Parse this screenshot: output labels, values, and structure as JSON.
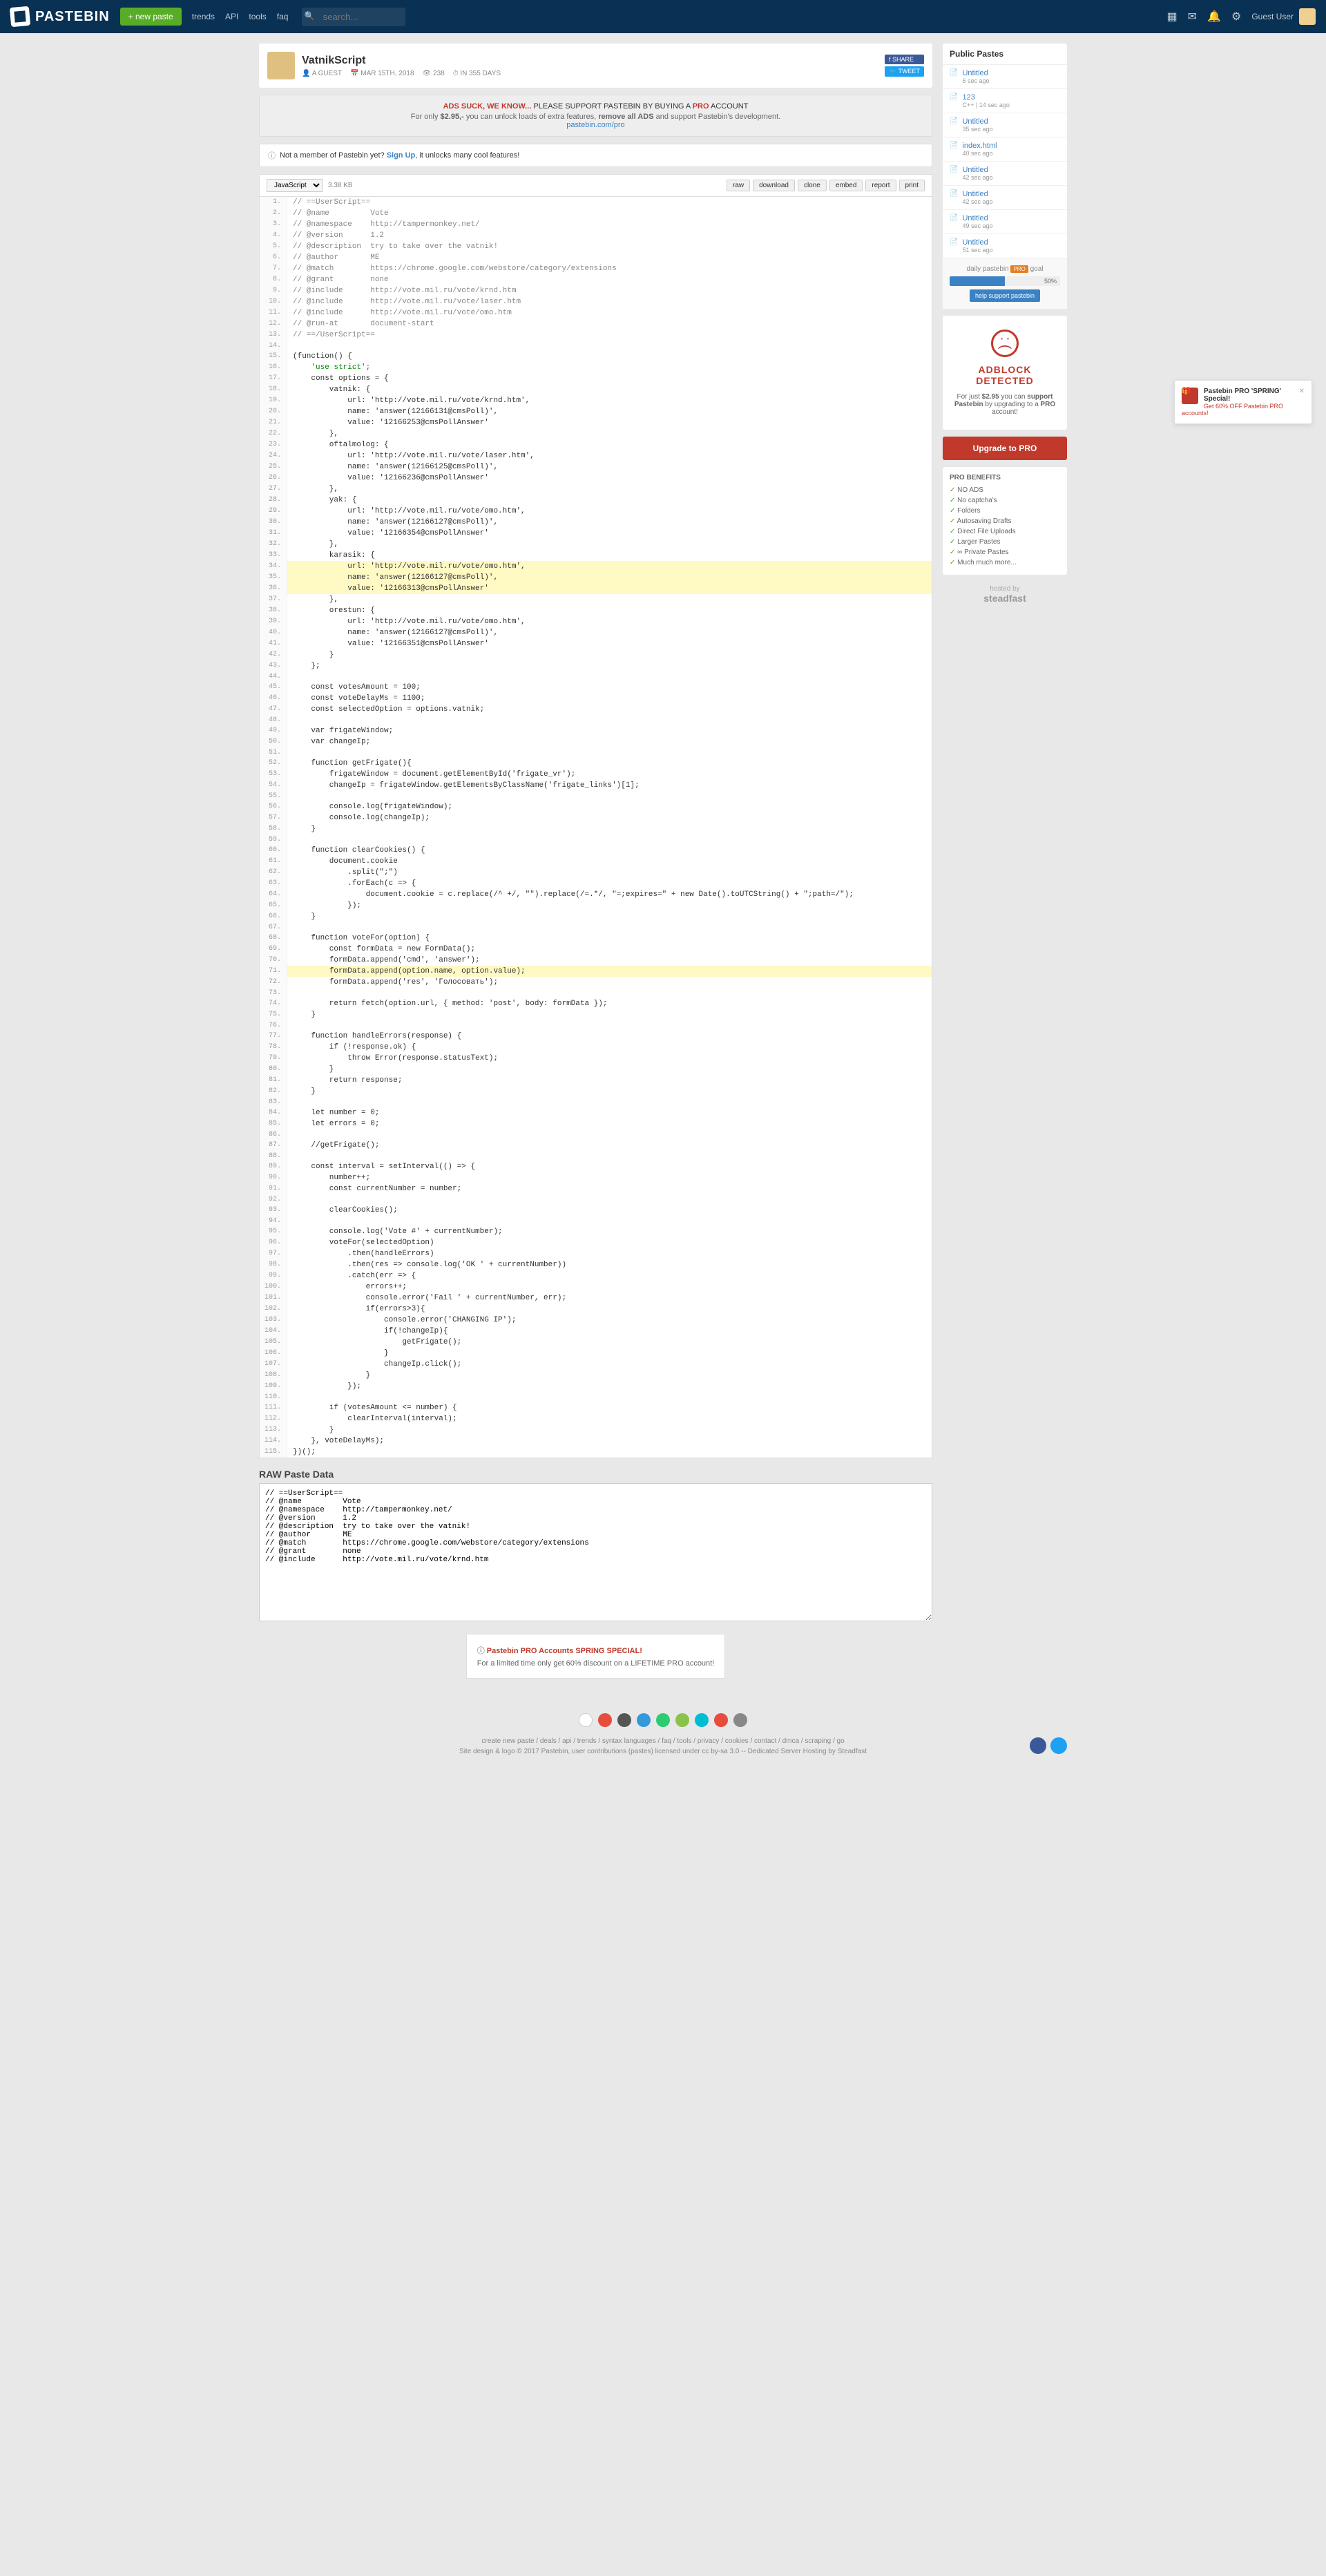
{
  "header": {
    "logo": "PASTEBIN",
    "new_paste": "+ new paste",
    "nav": [
      "trends",
      "API",
      "tools",
      "faq"
    ],
    "search_placeholder": "search...",
    "guest": "Guest User"
  },
  "paste": {
    "title": "VatnikScript",
    "author": "A GUEST",
    "date": "MAR 15TH, 2018",
    "views": "238",
    "expires": "IN 355 DAYS",
    "share": "SHARE",
    "tweet": "TWEET",
    "lang": "JavaScript",
    "size": "3.38 KB"
  },
  "ads": {
    "title": "ADS SUCK, WE KNOW...",
    "suffix": " PLEASE SUPPORT PASTEBIN BY BUYING A ",
    "pro": "PRO",
    "account": " ACCOUNT",
    "text1": "For only ",
    "price": "$2.95,-",
    "text2": " you can unlock loads of extra features, ",
    "bold": "remove all ADS",
    "text3": " and support Pastebin's development.",
    "link": "pastebin.com/pro"
  },
  "member": {
    "text1": "Not a member of Pastebin yet? ",
    "signup": "Sign Up",
    "text2": ", it unlocks many cool features!"
  },
  "toolbar": [
    "raw",
    "download",
    "clone",
    "embed",
    "report",
    "print"
  ],
  "code": [
    {
      "n": 1,
      "t": "// ==UserScript==",
      "c": "com"
    },
    {
      "n": 2,
      "t": "// @name         Vote",
      "c": "com"
    },
    {
      "n": 3,
      "t": "// @namespace    http://tampermonkey.net/",
      "c": "com"
    },
    {
      "n": 4,
      "t": "// @version      1.2",
      "c": "com"
    },
    {
      "n": 5,
      "t": "// @description  try to take over the vatnik!",
      "c": "com"
    },
    {
      "n": 6,
      "t": "// @author       ME",
      "c": "com"
    },
    {
      "n": 7,
      "t": "// @match        https://chrome.google.com/webstore/category/extensions",
      "c": "com"
    },
    {
      "n": 8,
      "t": "// @grant        none",
      "c": "com"
    },
    {
      "n": 9,
      "t": "// @include      http://vote.mil.ru/vote/krnd.htm",
      "c": "com"
    },
    {
      "n": 10,
      "t": "// @include      http://vote.mil.ru/vote/laser.htm",
      "c": "com"
    },
    {
      "n": 11,
      "t": "// @include      http://vote.mil.ru/vote/omo.htm",
      "c": "com"
    },
    {
      "n": 12,
      "t": "// @run-at       document-start",
      "c": "com"
    },
    {
      "n": 13,
      "t": "// ==/UserScript==",
      "c": "com"
    },
    {
      "n": 14,
      "t": ""
    },
    {
      "n": 15,
      "t": "(function() {"
    },
    {
      "n": 16,
      "t": "    'use strict';",
      "c": "str"
    },
    {
      "n": 17,
      "t": "    const options = {"
    },
    {
      "n": 18,
      "t": "        vatnik: {"
    },
    {
      "n": 19,
      "t": "            url: 'http://vote.mil.ru/vote/krnd.htm',"
    },
    {
      "n": 20,
      "t": "            name: 'answer(12166131@cmsPoll)',"
    },
    {
      "n": 21,
      "t": "            value: '12166253@cmsPollAnswer'"
    },
    {
      "n": 22,
      "t": "        },"
    },
    {
      "n": 23,
      "t": "        oftalmolog: {"
    },
    {
      "n": 24,
      "t": "            url: 'http://vote.mil.ru/vote/laser.htm',"
    },
    {
      "n": 25,
      "t": "            name: 'answer(12166125@cmsPoll)',"
    },
    {
      "n": 26,
      "t": "            value: '12166236@cmsPollAnswer'"
    },
    {
      "n": 27,
      "t": "        },"
    },
    {
      "n": 28,
      "t": "        yak: {"
    },
    {
      "n": 29,
      "t": "            url: 'http://vote.mil.ru/vote/omo.htm',"
    },
    {
      "n": 30,
      "t": "            name: 'answer(12166127@cmsPoll)',"
    },
    {
      "n": 31,
      "t": "            value: '12166354@cmsPollAnswer'"
    },
    {
      "n": 32,
      "t": "        },"
    },
    {
      "n": 33,
      "t": "        karasik: {"
    },
    {
      "n": 34,
      "t": "            url: 'http://vote.mil.ru/vote/omo.htm',",
      "hl": true
    },
    {
      "n": 35,
      "t": "            name: 'answer(12166127@cmsPoll)',",
      "hl": true
    },
    {
      "n": 36,
      "t": "            value: '12166313@cmsPollAnswer'",
      "hl": true
    },
    {
      "n": 37,
      "t": "        },"
    },
    {
      "n": 38,
      "t": "        orestun: {"
    },
    {
      "n": 39,
      "t": "            url: 'http://vote.mil.ru/vote/omo.htm',"
    },
    {
      "n": 40,
      "t": "            name: 'answer(12166127@cmsPoll)',"
    },
    {
      "n": 41,
      "t": "            value: '12166351@cmsPollAnswer'"
    },
    {
      "n": 42,
      "t": "        }"
    },
    {
      "n": 43,
      "t": "    };"
    },
    {
      "n": 44,
      "t": ""
    },
    {
      "n": 45,
      "t": "    const votesAmount = 100;"
    },
    {
      "n": 46,
      "t": "    const voteDelayMs = 1100;"
    },
    {
      "n": 47,
      "t": "    const selectedOption = options.vatnik;"
    },
    {
      "n": 48,
      "t": ""
    },
    {
      "n": 49,
      "t": "    var frigateWindow;"
    },
    {
      "n": 50,
      "t": "    var changeIp;"
    },
    {
      "n": 51,
      "t": ""
    },
    {
      "n": 52,
      "t": "    function getFrigate(){"
    },
    {
      "n": 53,
      "t": "        frigateWindow = document.getElementById('frigate_vr');"
    },
    {
      "n": 54,
      "t": "        changeIp = frigateWindow.getElementsByClassName('frigate_links')[1];"
    },
    {
      "n": 55,
      "t": ""
    },
    {
      "n": 56,
      "t": "        console.log(frigateWindow);"
    },
    {
      "n": 57,
      "t": "        console.log(changeIp);"
    },
    {
      "n": 58,
      "t": "    }"
    },
    {
      "n": 59,
      "t": ""
    },
    {
      "n": 60,
      "t": "    function clearCookies() {"
    },
    {
      "n": 61,
      "t": "        document.cookie"
    },
    {
      "n": 62,
      "t": "            .split(\";\")"
    },
    {
      "n": 63,
      "t": "            .forEach(c => {"
    },
    {
      "n": 64,
      "t": "                document.cookie = c.replace(/^ +/, \"\").replace(/=.*/, \"=;expires=\" + new Date().toUTCString() + \";path=/\");"
    },
    {
      "n": 65,
      "t": "            });"
    },
    {
      "n": 66,
      "t": "    }"
    },
    {
      "n": 67,
      "t": ""
    },
    {
      "n": 68,
      "t": "    function voteFor(option) {"
    },
    {
      "n": 69,
      "t": "        const formData = new FormData();"
    },
    {
      "n": 70,
      "t": "        formData.append('cmd', 'answer');"
    },
    {
      "n": 71,
      "t": "        formData.append(option.name, option.value);",
      "hl": true
    },
    {
      "n": 72,
      "t": "        formData.append('res', 'Голосовать');"
    },
    {
      "n": 73,
      "t": ""
    },
    {
      "n": 74,
      "t": "        return fetch(option.url, { method: 'post', body: formData });"
    },
    {
      "n": 75,
      "t": "    }"
    },
    {
      "n": 76,
      "t": ""
    },
    {
      "n": 77,
      "t": "    function handleErrors(response) {"
    },
    {
      "n": 78,
      "t": "        if (!response.ok) {"
    },
    {
      "n": 79,
      "t": "            throw Error(response.statusText);"
    },
    {
      "n": 80,
      "t": "        }"
    },
    {
      "n": 81,
      "t": "        return response;"
    },
    {
      "n": 82,
      "t": "    }"
    },
    {
      "n": 83,
      "t": ""
    },
    {
      "n": 84,
      "t": "    let number = 0;"
    },
    {
      "n": 85,
      "t": "    let errors = 0;"
    },
    {
      "n": 86,
      "t": ""
    },
    {
      "n": 87,
      "t": "    //getFrigate();"
    },
    {
      "n": 88,
      "t": ""
    },
    {
      "n": 89,
      "t": "    const interval = setInterval(() => {"
    },
    {
      "n": 90,
      "t": "        number++;"
    },
    {
      "n": 91,
      "t": "        const currentNumber = number;"
    },
    {
      "n": 92,
      "t": ""
    },
    {
      "n": 93,
      "t": "        clearCookies();"
    },
    {
      "n": 94,
      "t": ""
    },
    {
      "n": 95,
      "t": "        console.log('Vote #' + currentNumber);"
    },
    {
      "n": 96,
      "t": "        voteFor(selectedOption)"
    },
    {
      "n": 97,
      "t": "            .then(handleErrors)"
    },
    {
      "n": 98,
      "t": "            .then(res => console.log('OK ' + currentNumber))"
    },
    {
      "n": 99,
      "t": "            .catch(err => {"
    },
    {
      "n": 100,
      "t": "                errors++;"
    },
    {
      "n": 101,
      "t": "                console.error('Fail ' + currentNumber, err);"
    },
    {
      "n": 102,
      "t": "                if(errors>3){"
    },
    {
      "n": 103,
      "t": "                    console.error('CHANGING IP');"
    },
    {
      "n": 104,
      "t": "                    if(!changeIp){"
    },
    {
      "n": 105,
      "t": "                        getFrigate();"
    },
    {
      "n": 106,
      "t": "                    }"
    },
    {
      "n": 107,
      "t": "                    changeIp.click();"
    },
    {
      "n": 108,
      "t": "                }"
    },
    {
      "n": 109,
      "t": "            });"
    },
    {
      "n": 110,
      "t": ""
    },
    {
      "n": 111,
      "t": "        if (votesAmount <= number) {"
    },
    {
      "n": 112,
      "t": "            clearInterval(interval);"
    },
    {
      "n": 113,
      "t": "        }"
    },
    {
      "n": 114,
      "t": "    }, voteDelayMs);"
    },
    {
      "n": 115,
      "t": "})();"
    }
  ],
  "raw_title": "RAW Paste Data",
  "raw_content": "// ==UserScript==\n// @name         Vote\n// @namespace    http://tampermonkey.net/\n// @version      1.2\n// @description  try to take over the vatnik!\n// @author       ME\n// @match        https://chrome.google.com/webstore/category/extensions\n// @grant        none\n// @include      http://vote.mil.ru/vote/krnd.htm",
  "promo": {
    "title": "Pastebin PRO Accounts SPRING SPECIAL!",
    "text": "For a limited time only get 60% discount on a LIFETIME PRO account!"
  },
  "sidebar": {
    "public_title": "Public Pastes",
    "items": [
      {
        "title": "Untitled",
        "meta": "6 sec ago"
      },
      {
        "title": "123",
        "meta": "C++ | 14 sec ago"
      },
      {
        "title": "Untitled",
        "meta": "35 sec ago"
      },
      {
        "title": "index.html",
        "meta": "40 sec ago"
      },
      {
        "title": "Untitled",
        "meta": "42 sec ago"
      },
      {
        "title": "Untitled",
        "meta": "42 sec ago"
      },
      {
        "title": "Untitled",
        "meta": "49 sec ago"
      },
      {
        "title": "Untitled",
        "meta": "51 sec ago"
      }
    ],
    "goal_text": "daily pastebin",
    "goal_pro": "PRO",
    "goal_suffix": " goal",
    "goal_pct": "50%",
    "support_btn": "help support pastebin",
    "adblock_title": "ADBLOCK DETECTED",
    "adblock_text1": "For just ",
    "adblock_price": "$2.95",
    "adblock_text2": " you can ",
    "adblock_bold1": "support Pastebin",
    "adblock_text3": " by upgrading to a ",
    "adblock_bold2": "PRO",
    "adblock_text4": " account!",
    "upgrade": "Upgrade to PRO",
    "benefits_title": "PRO BENEFITS",
    "benefits": [
      "NO ADS",
      "No captcha's",
      "Folders",
      "Autosaving Drafts",
      "Direct File Uploads",
      "Larger Pastes",
      "∞ Private Pastes",
      "Much much more..."
    ],
    "hosted_by": "hosted by",
    "hosted_logo": "steadfast"
  },
  "popup": {
    "title": "Pastebin PRO 'SPRING' Special!",
    "text": "Get 60% OFF Pastebin PRO accounts!"
  },
  "footer": {
    "links": "create new paste  /  deals  /  api  /  trends  /  syntax languages  /  faq  /  tools  /  privacy  /  cookies  /  contact  /  dmca  /  scraping  /  go",
    "copyright": "Site design & logo © 2017 Pastebin, user contributions (pastes) licensed under cc by-sa 3.0 -- Dedicated Server Hosting by Steadfast"
  }
}
